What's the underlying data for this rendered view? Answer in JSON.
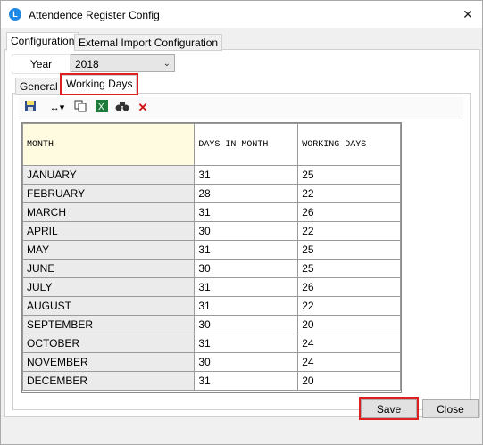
{
  "window": {
    "title": "Attendence Register Config"
  },
  "outer_tabs": [
    "Configuration",
    "External Import Configuration"
  ],
  "year": {
    "label": "Year",
    "value": "2018"
  },
  "inner_tabs": [
    "General",
    "Working Days"
  ],
  "table": {
    "headers": [
      "MONTH",
      "DAYS IN MONTH",
      "WORKING DAYS"
    ],
    "rows": [
      [
        "JANUARY",
        "31",
        "25"
      ],
      [
        "FEBRUARY",
        "28",
        "22"
      ],
      [
        "MARCH",
        "31",
        "26"
      ],
      [
        "APRIL",
        "30",
        "22"
      ],
      [
        "MAY",
        "31",
        "25"
      ],
      [
        "JUNE",
        "30",
        "25"
      ],
      [
        "JULY",
        "31",
        "26"
      ],
      [
        "AUGUST",
        "31",
        "22"
      ],
      [
        "SEPTEMBER",
        "30",
        "20"
      ],
      [
        "OCTOBER",
        "31",
        "24"
      ],
      [
        "NOVEMBER",
        "30",
        "24"
      ],
      [
        "DECEMBER",
        "31",
        "20"
      ]
    ]
  },
  "buttons": {
    "save": "Save",
    "close": "Close"
  },
  "toolbar_icons": [
    "save-icon",
    "column-resize-icon",
    "copy-icon",
    "excel-export-icon",
    "find-icon",
    "delete-icon"
  ],
  "colors": {
    "highlight": "#e02020",
    "header_cell": "#fffbe0"
  }
}
